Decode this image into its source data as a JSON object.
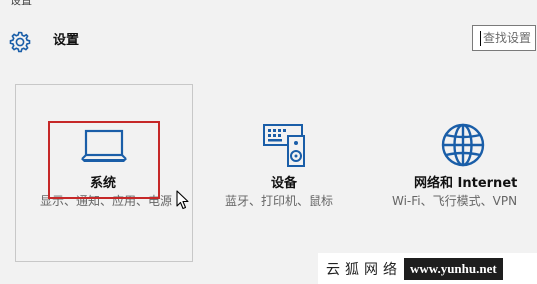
{
  "window": {
    "title": "设置"
  },
  "header": {
    "title": "设置",
    "icon": "gear-icon"
  },
  "search": {
    "placeholder": "查找设置",
    "value": ""
  },
  "tiles": [
    {
      "id": "system",
      "icon": "laptop-icon",
      "label": "系统",
      "desc": "显示、通知、应用、电源"
    },
    {
      "id": "devices",
      "icon": "devices-icon",
      "label": "设备",
      "desc": "蓝牙、打印机、鼠标"
    },
    {
      "id": "network",
      "icon": "globe-icon",
      "label": "网络和 Internet",
      "desc": "Wi-Fi、飞行模式、VPN"
    }
  ],
  "colors": {
    "accent": "#1a5ea8",
    "highlight": "#c62828",
    "background": "#f2f2f2"
  },
  "watermark": {
    "text_cn": "云狐网络",
    "url": "www.yunhu.net"
  }
}
